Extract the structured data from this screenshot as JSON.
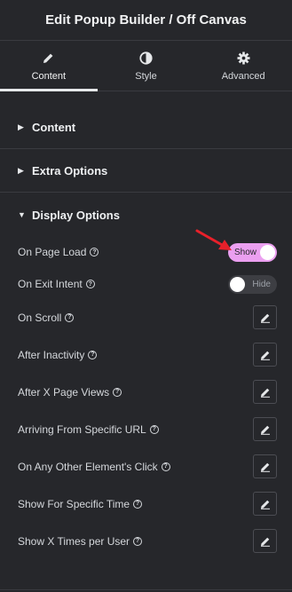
{
  "header": {
    "title": "Edit Popup Builder / Off Canvas"
  },
  "tabs": [
    {
      "label": "Content",
      "icon": "pencil-icon",
      "active": true
    },
    {
      "label": "Style",
      "icon": "half-circle-icon",
      "active": false
    },
    {
      "label": "Advanced",
      "icon": "gear-icon",
      "active": false
    }
  ],
  "sections": [
    {
      "label": "Content",
      "expanded": false
    },
    {
      "label": "Extra Options",
      "expanded": false
    },
    {
      "label": "Display Options",
      "expanded": true
    }
  ],
  "display_options": {
    "on_page_load": {
      "label": "On Page Load",
      "toggle_label": "Show",
      "value": true
    },
    "on_exit_intent": {
      "label": "On Exit Intent",
      "toggle_label": "Hide",
      "value": false
    },
    "edit_rows": [
      {
        "label": "On Scroll"
      },
      {
        "label": "After Inactivity"
      },
      {
        "label": "After X Page Views"
      },
      {
        "label": "Arriving From Specific URL"
      },
      {
        "label": "On Any Other Element's Click"
      },
      {
        "label": "Show For Specific Time"
      },
      {
        "label": "Show X Times per User"
      }
    ]
  },
  "colors": {
    "background": "#26272b",
    "toggle_on": "#eb9ff0",
    "annotation_arrow": "#e8202a"
  }
}
